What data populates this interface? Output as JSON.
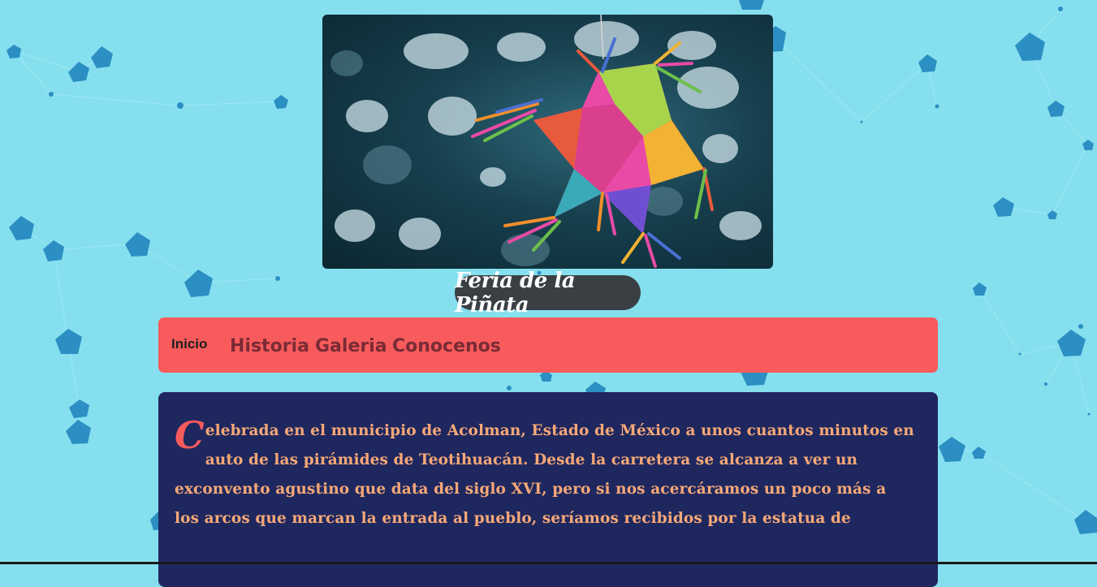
{
  "site": {
    "title": "Feria de la Piñata"
  },
  "hero": {
    "icon": "pinata-image"
  },
  "nav": {
    "items": [
      {
        "label": "Inicio"
      },
      {
        "label": "Historia"
      },
      {
        "label": "Galeria"
      },
      {
        "label": "Conocenos"
      }
    ]
  },
  "article": {
    "dropcap": "C",
    "text": "elebrada en el municipio de Acolman, Estado de México a unos cuantos minutos en auto de las pirámides de Teotihuacán. Desde la carretera se alcanza a ver un exconvento agustino que data del siglo XVI, pero si nos acercáramos un poco más a los arcos que marcan la entrada al pueblo, seríamos recibidos por la estatua de"
  },
  "colors": {
    "background": "#85dfee",
    "nav_bg": "#f85b5c",
    "article_bg": "#1f275f",
    "article_text": "#f6a877",
    "pill_bg": "#3a3f44"
  }
}
